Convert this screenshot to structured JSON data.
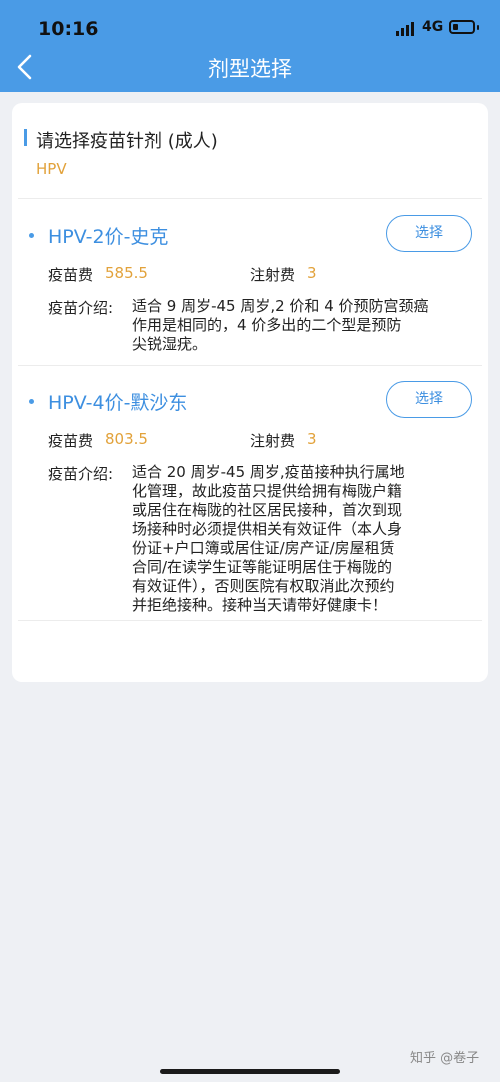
{
  "status_bar": {
    "time": "10:16",
    "network": "4G"
  },
  "header": {
    "title": "剂型选择"
  },
  "section": {
    "title": "请选择疫苗针剂 (成人)",
    "subtitle": "HPV"
  },
  "vaccines": [
    {
      "name": "HPV-2价-史克",
      "select_label": "选择",
      "fee_label": "疫苗费",
      "fee_value": "585.5",
      "injection_label": "注射费",
      "injection_value": "3",
      "intro_label": "疫苗介绍:",
      "intro_lines": [
        "适合 9 周岁-45 周岁,2 价和 4 价预防宫颈癌",
        "作用是相同的，4 价多出的二个型是预防",
        "尖锐湿疣。"
      ]
    },
    {
      "name": "HPV-4价-默沙东",
      "select_label": "选择",
      "fee_label": "疫苗费",
      "fee_value": "803.5",
      "injection_label": "注射费",
      "injection_value": "3",
      "intro_label": "疫苗介绍:",
      "intro_lines": [
        "适合 20 周岁-45 周岁,疫苗接种执行属地",
        "化管理，故此疫苗只提供给拥有梅陇户籍",
        "或居住在梅陇的社区居民接种，首次到现",
        "场接种时必须提供相关有效证件（本人身",
        "份证+户口簿或居住证/房产证/房屋租赁",
        "合同/在读学生证等能证明居住于梅陇的",
        "有效证件），否则医院有权取消此次预约",
        "并拒绝接种。接种当天请带好健康卡！"
      ]
    }
  ],
  "watermark": "知乎 @卷子",
  "colors": {
    "primary": "#4a9be6",
    "accent": "#e2a23b",
    "background": "#eef0f4"
  },
  "icons": [
    "back-chevron-icon",
    "signal-icon",
    "battery-icon"
  ]
}
